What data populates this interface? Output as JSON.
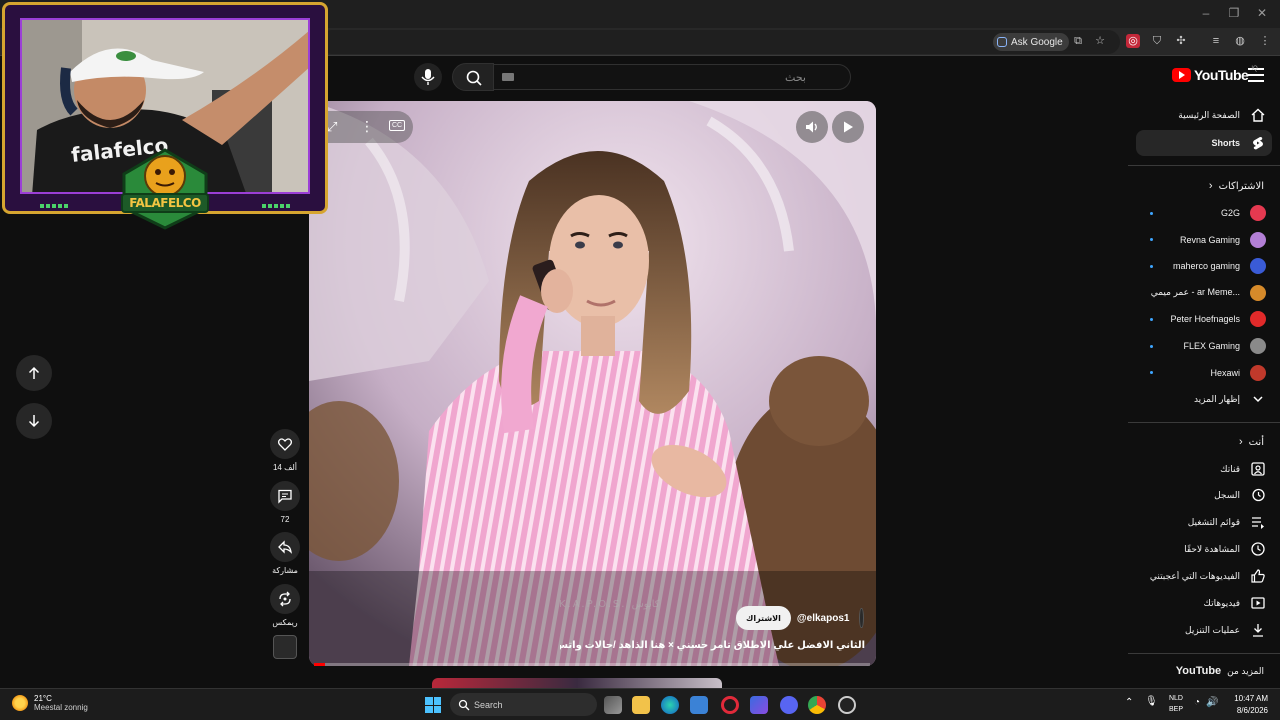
{
  "browser": {
    "ask_google": "Ask Google"
  },
  "youtube": {
    "logo_text": "YouTube",
    "logo_region": "IQ",
    "search_placeholder": "بحث"
  },
  "sidebar": {
    "main": [
      {
        "label": "الصفحة الرئيسية",
        "icon": "home-icon"
      },
      {
        "label": "Shorts",
        "icon": "shorts-icon",
        "active": true
      }
    ],
    "subscriptions_header": "الاشتراكات",
    "subscriptions": [
      {
        "label": "G2G",
        "color": "#e53950",
        "live": true
      },
      {
        "label": "Revna Gaming",
        "color": "#b37fd6",
        "live": true
      },
      {
        "label": "maherco gaming",
        "color": "#3a5bd6",
        "live": true
      },
      {
        "label": "عمر ميمي - ar Meme...",
        "color": "#d68a2a",
        "live": false
      },
      {
        "label": "Peter Hoefnagels",
        "color": "#e12a2a",
        "live": true
      },
      {
        "label": "FLEX Gaming",
        "color": "#8a8a8a",
        "live": true
      },
      {
        "label": "Hexawi",
        "color": "#c0392b",
        "live": true
      }
    ],
    "show_more": "إظهار المزيد",
    "you_header": "أنت",
    "you_items": [
      {
        "label": "قناتك",
        "icon": "channel-icon"
      },
      {
        "label": "السجل",
        "icon": "history-icon"
      },
      {
        "label": "قوائم التشغيل",
        "icon": "playlists-icon"
      },
      {
        "label": "المشاهدة لاحقًا",
        "icon": "watch-later-icon"
      },
      {
        "label": "الفيديوهات التي أعجبتني",
        "icon": "thumbs-up-icon"
      },
      {
        "label": "فيديوهاتك",
        "icon": "your-videos-icon"
      },
      {
        "label": "عمليات التنزيل",
        "icon": "download-icon"
      }
    ],
    "more_from": "المزيد من",
    "more_from_brand": "YouTube"
  },
  "short": {
    "channel_handle": "@elkapos1",
    "subscribe_label": "الاشتراك",
    "title": "الثاني الافضل علي الاطلاق تامر حسني × هنا الذاهد /حالات واتس /...",
    "watermark": "K.A.P.O.S. كابوس",
    "progress": 0.02
  },
  "actions": {
    "likes": "14 ألف",
    "comments": "72",
    "share": "مشاركة",
    "remix": "ريمكس"
  },
  "webcam": {
    "badge_text": "FALAFELCO",
    "shirt_text": "falafelco"
  },
  "taskbar": {
    "temperature": "21°C",
    "weather": "Meestal zonnig",
    "search": "Search",
    "lang_line1": "NLD",
    "lang_line2": "BEP",
    "time": "10:47 AM",
    "date": "8/6/2026"
  }
}
